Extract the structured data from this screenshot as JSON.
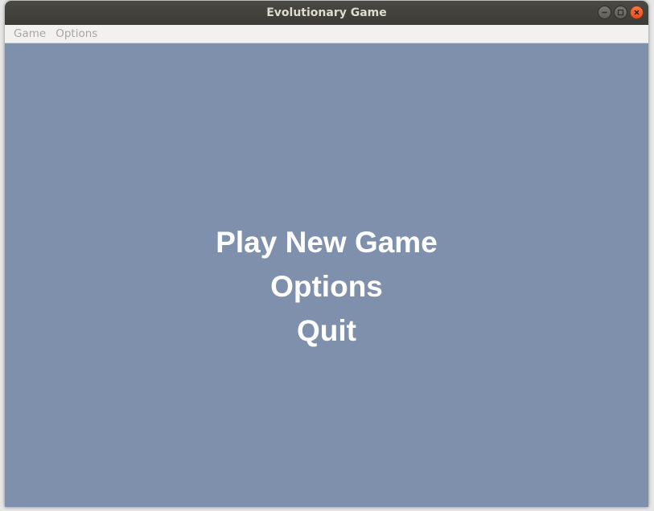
{
  "window": {
    "title": "Evolutionary Game",
    "controls": [
      "minimize-icon",
      "maximize-icon",
      "close-icon"
    ]
  },
  "menubar": {
    "items": [
      {
        "label": "Game"
      },
      {
        "label": "Options"
      }
    ]
  },
  "main_menu": {
    "options": [
      {
        "label": "Play New Game"
      },
      {
        "label": "Options"
      },
      {
        "label": "Quit"
      }
    ]
  },
  "colors": {
    "background": "#7f90ad",
    "menu_text": "#ffffff",
    "titlebar": "#3c3b37",
    "close_button": "#e95420"
  }
}
